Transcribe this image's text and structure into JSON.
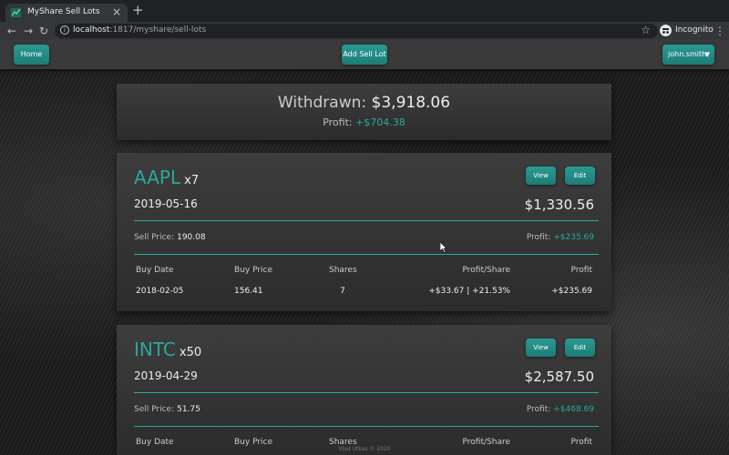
{
  "browser": {
    "tab_title": "MyShare Sell Lots",
    "tab_close": "×",
    "new_tab": "+",
    "url_host": "localhost",
    "url_path": ":1817/myshare/sell-lots",
    "profile_label": "Incognito",
    "icons": [
      "back-icon",
      "forward-icon",
      "reload-icon",
      "info-icon",
      "star-icon",
      "incognito-icon",
      "kebab-icon"
    ]
  },
  "nav": {
    "home_label": "Home",
    "add_label": "Add Sell Lot",
    "user_label": "john.smith"
  },
  "summary": {
    "withdrawn_label": "Withdrawn:",
    "withdrawn_value": "$3,918.06",
    "profit_label": "Profit:",
    "profit_value": "+$704.38"
  },
  "lots": [
    {
      "ticker": "AAPL",
      "qty": "x7",
      "date": "2019-05-16",
      "total": "$1,330.56",
      "sell_price_label": "Sell Price:",
      "sell_price": "190.08",
      "profit_label": "Profit:",
      "profit": "+$235.69",
      "view_label": "View",
      "edit_label": "Edit",
      "headers": [
        "Buy Date",
        "Buy Price",
        "Shares",
        "Profit/Share",
        "Profit"
      ],
      "rows": [
        [
          "2018-02-05",
          "156.41",
          "7",
          "+$33.67 | +21.53%",
          "+$235.69"
        ]
      ]
    },
    {
      "ticker": "INTC",
      "qty": "x50",
      "date": "2019-04-29",
      "total": "$2,587.50",
      "sell_price_label": "Sell Price:",
      "sell_price": "51.75",
      "profit_label": "Profit:",
      "profit": "+$468.69",
      "view_label": "View",
      "edit_label": "Edit",
      "headers": [
        "Buy Date",
        "Buy Price",
        "Shares",
        "Profit/Share",
        "Profit"
      ]
    }
  ],
  "footer": "Vlad Utkas © 2020",
  "colors": {
    "accent": "#2aa89d",
    "card": "#353535",
    "appbar": "#3a3a3a"
  }
}
